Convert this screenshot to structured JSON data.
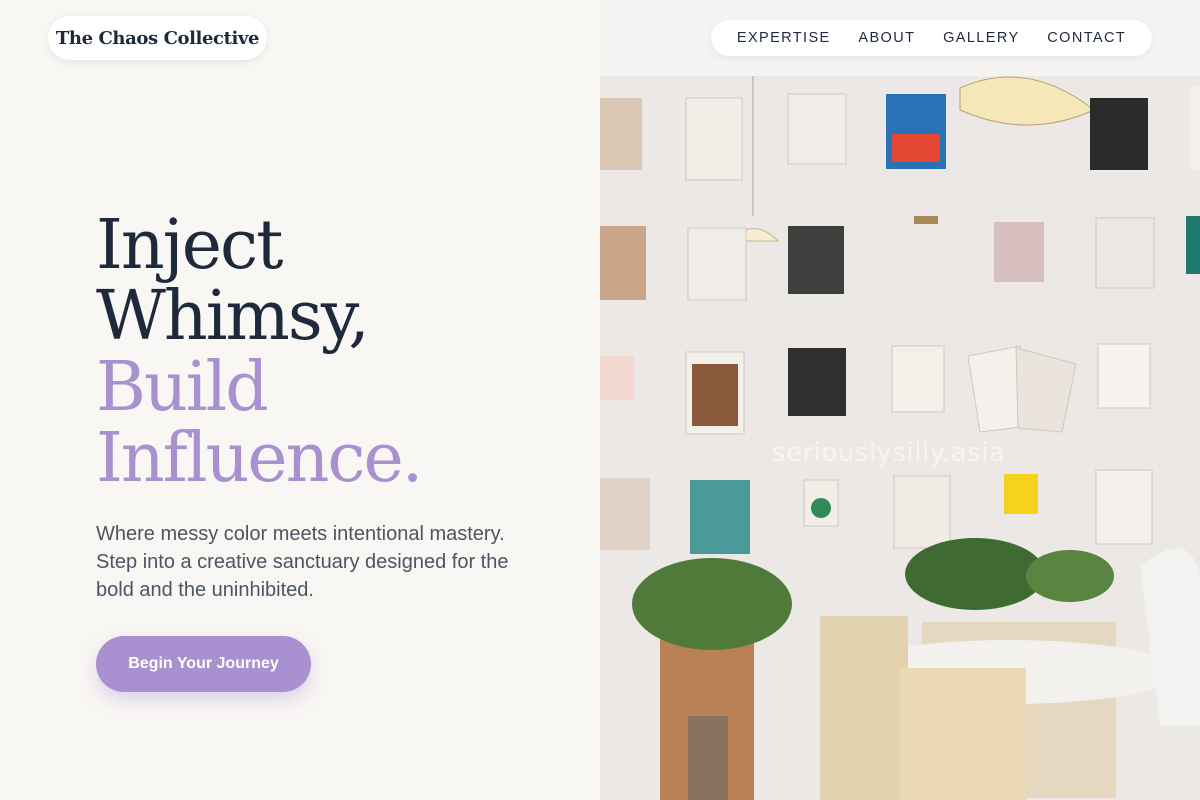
{
  "brand": {
    "name": "The Chaos Collective"
  },
  "nav": {
    "items": [
      {
        "label": "EXPERTISE"
      },
      {
        "label": "ABOUT"
      },
      {
        "label": "GALLERY"
      },
      {
        "label": "CONTACT"
      }
    ]
  },
  "hero": {
    "title_lines": [
      "Inject",
      "Whimsy,",
      "Build",
      "Influence."
    ],
    "subtitle": "Where messy color meets intentional mastery. Step into a creative sanctuary designed for the bold and the uninhibited.",
    "cta_label": "Begin Your Journey"
  },
  "photo": {
    "watermark": "seriouslysilly.asia"
  },
  "colors": {
    "background": "#f9f7f4",
    "text_dark": "#1e293b",
    "accent": "#a990d0",
    "body_text": "#4b5563"
  }
}
